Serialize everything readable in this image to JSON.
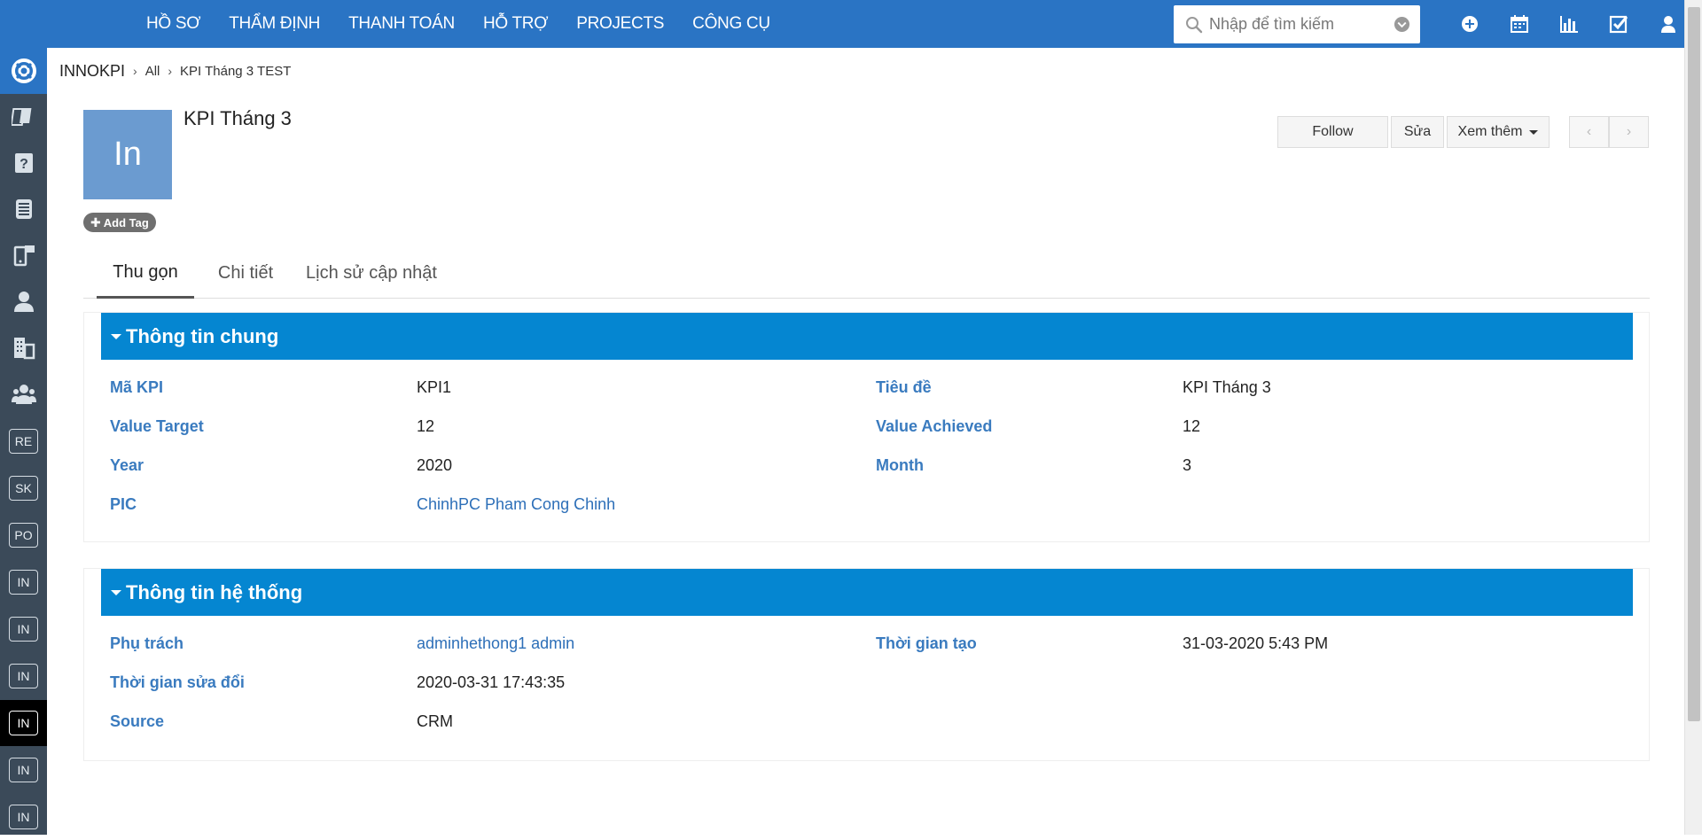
{
  "topnav": {
    "items": [
      "HỒ SƠ",
      "THẨM ĐỊNH",
      "THANH TOÁN",
      "HỖ TRỢ",
      "PROJECTS",
      "CÔNG CỤ"
    ],
    "search_placeholder": "Nhập để tìm kiếm",
    "icons": [
      "plus-circle-icon",
      "calendar-icon",
      "bar-chart-icon",
      "checkbox-icon",
      "user-icon"
    ]
  },
  "sidebar": {
    "icons": [
      "support-icon",
      "cards-icon",
      "question-book-icon",
      "ledger-icon",
      "mobile-chat-icon",
      "person-icon",
      "building-icon",
      "group-icon"
    ],
    "boxes": [
      "RE",
      "SK",
      "PO",
      "IN",
      "IN",
      "IN",
      "IN",
      "IN",
      "IN"
    ],
    "active_index": 6
  },
  "breadcrumb": {
    "root": "INNOKPI",
    "level1": "All",
    "level2": "KPI Tháng 3 TEST"
  },
  "record": {
    "avatar_text": "In",
    "title": "KPI Tháng 3",
    "add_tag": "Add Tag"
  },
  "actions": {
    "follow": "Follow",
    "edit": "Sửa",
    "more": "Xem thêm",
    "prev": "‹",
    "next": "›"
  },
  "tabs": [
    "Thu gọn",
    "Chi tiết",
    "Lịch sử cập nhật"
  ],
  "general": {
    "title": "Thông tin chung",
    "kpi_code_label": "Mã KPI",
    "kpi_code": "KPI1",
    "subject_label": "Tiêu đề",
    "subject": "KPI Tháng 3",
    "value_target_label": "Value Target",
    "value_target": "12",
    "value_achieved_label": "Value Achieved",
    "value_achieved": "12",
    "year_label": "Year",
    "year": "2020",
    "month_label": "Month",
    "month": "3",
    "pic_label": "PIC",
    "pic": "ChinhPC Pham Cong Chinh"
  },
  "system": {
    "title": "Thông tin hệ thống",
    "assigned_label": "Phụ trách",
    "assigned": "adminhethong1 admin",
    "created_label": "Thời gian tạo",
    "created": "31-03-2020 5:43 PM",
    "modified_label": "Thời gian sửa đổi",
    "modified": "2020-03-31 17:43:35",
    "source_label": "Source",
    "source": "CRM"
  },
  "colors": {
    "topbar": "#2a74c4",
    "sidebar": "#3b4a59",
    "section_header": "#0586d1",
    "label": "#3a7bbf",
    "avatar": "#6b9bd0"
  }
}
